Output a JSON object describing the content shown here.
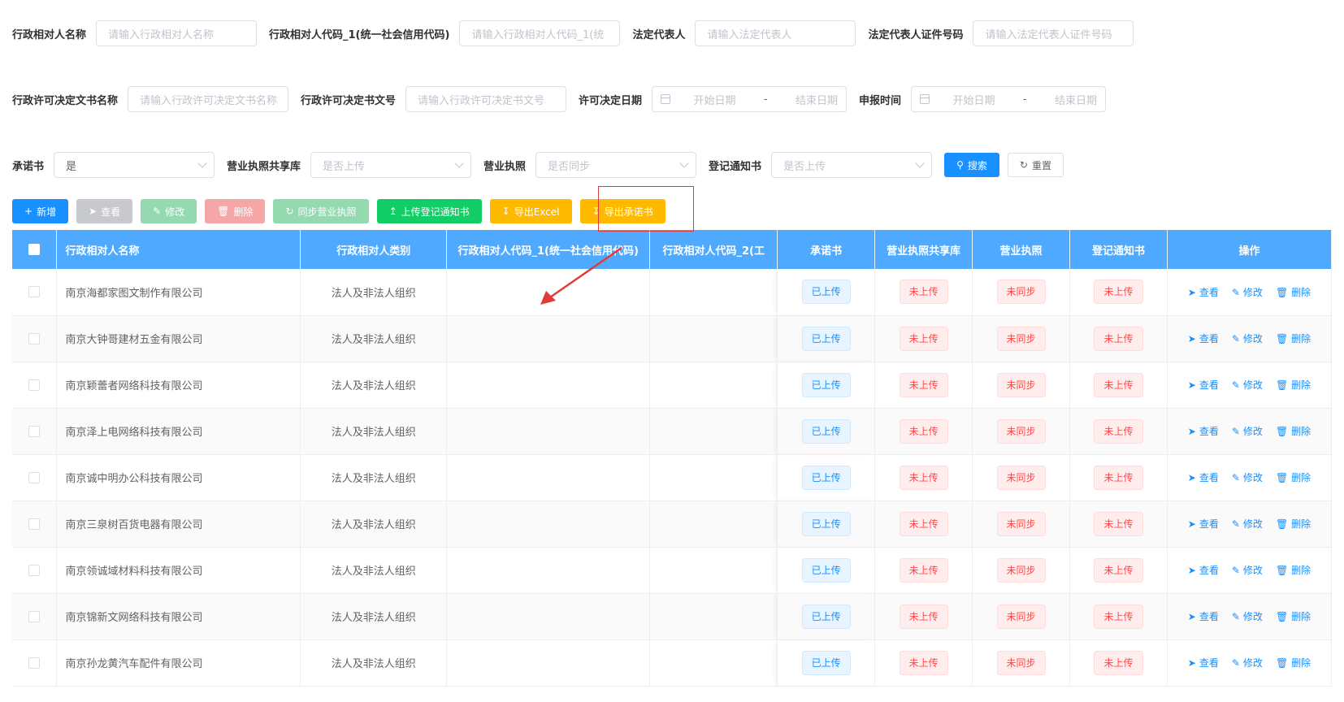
{
  "filters": {
    "row1": {
      "admin_name_label": "行政相对人名称",
      "admin_name_placeholder": "请输入行政相对人名称",
      "admin_code_label": "行政相对人代码_1(统一社会信用代码)",
      "admin_code_placeholder": "请输入行政相对人代码_1(统",
      "legal_rep_label": "法定代表人",
      "legal_rep_placeholder": "请输入法定代表人",
      "legal_rep_id_label": "法定代表人证件号码",
      "legal_rep_id_placeholder": "请输入法定代表人证件号码"
    },
    "row2": {
      "doc_name_label": "行政许可决定文书名称",
      "doc_name_placeholder": "请输入行政许可决定文书名称",
      "doc_no_label": "行政许可决定书文号",
      "doc_no_placeholder": "请输入行政许可决定书文号",
      "permit_date_label": "许可决定日期",
      "apply_time_label": "申报时间",
      "start_date": "开始日期",
      "range_sep": "-",
      "end_date": "结束日期"
    },
    "row3": {
      "commitment_label": "承诺书",
      "commitment_value": "是",
      "license_share_label": "营业执照共享库",
      "license_share_placeholder": "是否上传",
      "license_label": "营业执照",
      "license_placeholder": "是否同步",
      "notice_label": "登记通知书",
      "notice_placeholder": "是否上传",
      "search": "搜索",
      "reset": "重置"
    }
  },
  "toolbar": {
    "add": "新增",
    "view": "查看",
    "edit": "修改",
    "delete": "删除",
    "sync_license": "同步营业执照",
    "upload_notice": "上传登记通知书",
    "export_excel": "导出Excel",
    "export_commitment": "导出承诺书"
  },
  "table": {
    "headers": {
      "name": "行政相对人名称",
      "category": "行政相对人类别",
      "code1": "行政相对人代码_1(统一社会信用代码)",
      "code2": "行政相对人代码_2(工",
      "commitment": "承诺书",
      "license_share": "营业执照共享库",
      "license": "营业执照",
      "notice": "登记通知书",
      "actions": "操作"
    },
    "status": {
      "uploaded": "已上传",
      "not_uploaded": "未上传",
      "not_synced": "未同步"
    },
    "ops": {
      "view": "查看",
      "edit": "修改",
      "delete": "删除"
    },
    "rows": [
      {
        "name": "南京海都家图文制作有限公司",
        "category": "法人及非法人组织"
      },
      {
        "name": "南京大钟哥建材五金有限公司",
        "category": "法人及非法人组织"
      },
      {
        "name": "南京颖蕾者网络科技有限公司",
        "category": "法人及非法人组织"
      },
      {
        "name": "南京泽上电网络科技有限公司",
        "category": "法人及非法人组织"
      },
      {
        "name": "南京诚中明办公科技有限公司",
        "category": "法人及非法人组织"
      },
      {
        "name": "南京三泉树百货电器有限公司",
        "category": "法人及非法人组织"
      },
      {
        "name": "南京领诚域材料科技有限公司",
        "category": "法人及非法人组织"
      },
      {
        "name": "南京锦新文网络科技有限公司",
        "category": "法人及非法人组织"
      },
      {
        "name": "南京孙龙黄汽车配件有限公司",
        "category": "法人及非法人组织"
      }
    ]
  },
  "colors": {
    "primary": "#1890ff",
    "header_bg": "#4ea9ff",
    "danger": "#ff4949",
    "highlight": "#e03b3b"
  }
}
